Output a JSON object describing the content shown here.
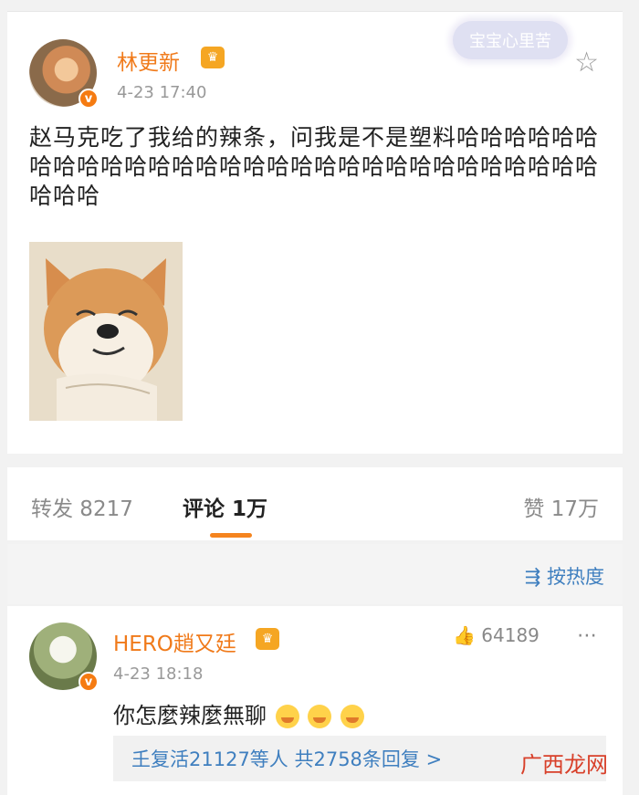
{
  "post": {
    "author": "林更新",
    "time": "4-23 17:40",
    "text": "赵马克吃了我给的辣条，问我是不是塑料哈哈哈哈哈哈哈哈哈哈哈哈哈哈哈哈哈哈哈哈哈哈哈哈哈哈哈哈哈哈哈哈哈",
    "sticker_text": "宝宝心里苦"
  },
  "stats": {
    "repost": "转发 8217",
    "comment": "评论 1万",
    "like": "赞 17万"
  },
  "sort_label": "按热度",
  "comment": {
    "author": "HERO趙又廷",
    "time": "4-23 18:18",
    "text": "你怎麼辣麼無聊",
    "likes": "64189",
    "replies": "𡈼复活21127等人 共2758条回复 >"
  },
  "watermark": "广西龙网",
  "icons": {
    "verified": "verified-badge",
    "crown": "vip-crown-icon",
    "star": "star-icon",
    "sort": "sort-icon",
    "thumb": "thumb-up-icon",
    "more": "more-icon",
    "emoji": "crying-emoji-icon"
  }
}
